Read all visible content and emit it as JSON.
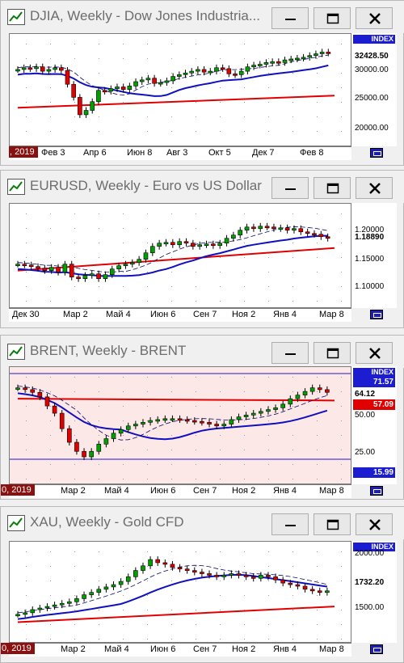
{
  "windows": [
    {
      "id": "djia",
      "title": "DJIA, Weekly - Dow Jones Industria...",
      "index_label": "INDEX",
      "last_price": "32428.50",
      "start_label": ", 2019",
      "y_ticks": [
        "30000.00",
        "25000.00",
        "20000.00"
      ],
      "x_ticks": [
        "Фев 3",
        "Апр 6",
        "Июн 8",
        "Авг 3",
        "Окт 5",
        "Дек 7",
        "Фев 8"
      ],
      "background": "#ffffff"
    },
    {
      "id": "eurusd",
      "title": "EURUSD, Weekly - Euro vs US Dollar",
      "index_label": "",
      "last_price": "1.18890",
      "start_label": "",
      "y_ticks": [
        "1.20000",
        "1.15000",
        "1.10000"
      ],
      "x_ticks": [
        "Дек 30",
        "Мар 2",
        "Май 4",
        "Июн 6",
        "Сен 7",
        "Ноя 2",
        "Янв 4",
        "Мар 8"
      ],
      "background": "#ffffff"
    },
    {
      "id": "brent",
      "title": "BRENT, Weekly - BRENT",
      "index_label": "INDEX",
      "upper_level": "71.57",
      "last_price": "64.12",
      "red_level": "57.09",
      "lower_level": "15.99",
      "start_label": "0, 2019",
      "y_ticks": [
        "50.00",
        "25.00"
      ],
      "x_ticks": [
        "Мар 2",
        "Май 4",
        "Июн 6",
        "Сен 7",
        "Ноя 2",
        "Янв 4",
        "Мар 8"
      ],
      "background": "#fde8e8"
    },
    {
      "id": "xau",
      "title": "XAU, Weekly - Gold CFD",
      "index_label": "INDEX",
      "last_price": "1732.20",
      "start_label": "0, 2019",
      "y_ticks": [
        "2000.00",
        "1500.00"
      ],
      "x_ticks": [
        "Мар 2",
        "Май 4",
        "Июн 6",
        "Сен 7",
        "Ноя 2",
        "Янв 4",
        "Мар 8"
      ],
      "background": "#ffffff"
    }
  ],
  "colors": {
    "bull": "#00a000",
    "bear": "#e00000",
    "ma_fast": "#1010c0",
    "ma_slow": "#e00000",
    "index_tag": "#1c1cd0",
    "start_tag": "#8b1010"
  },
  "icons": [
    "chart-app-icon",
    "minimize-icon",
    "maximize-icon",
    "close-icon"
  ]
}
